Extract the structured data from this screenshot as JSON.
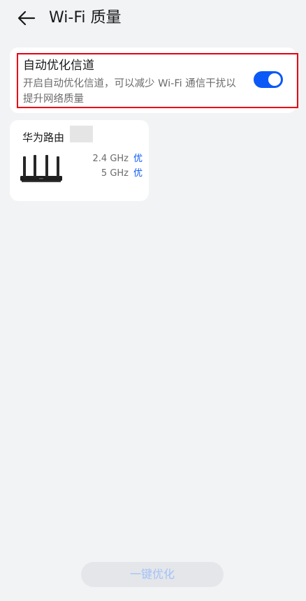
{
  "header": {
    "title": "Wi-Fi 质量",
    "back_icon": "arrow-left-icon"
  },
  "channel_setting": {
    "title": "自动优化信道",
    "description": "开启自动优化信道，可以减少 Wi-Fi 通信干扰以提升网络质量",
    "enabled": true,
    "toggle_color": "#0a59f7"
  },
  "router": {
    "name": "华为路由",
    "bands": [
      {
        "name": "2.4 GHz",
        "quality": "优"
      },
      {
        "name": "5 GHz",
        "quality": "优"
      }
    ]
  },
  "footer": {
    "optimize_label": "一键优化"
  },
  "colors": {
    "accent": "#0a59f7",
    "highlight": "#e60012",
    "background": "#f1f3f5"
  }
}
